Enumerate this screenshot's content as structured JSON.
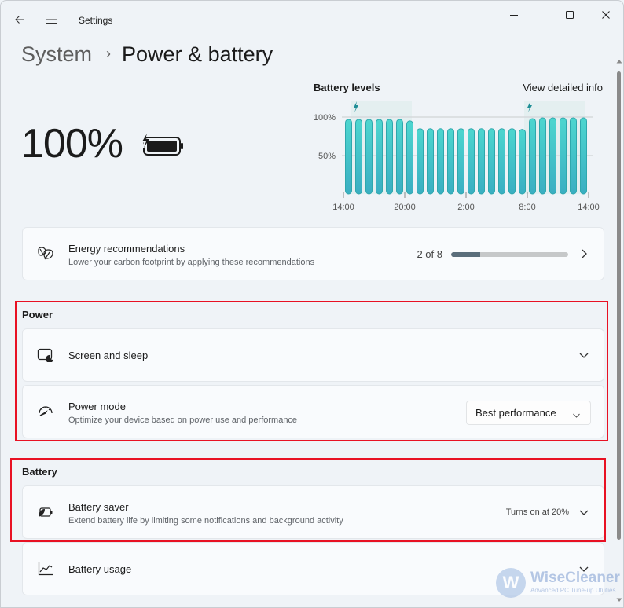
{
  "window": {
    "title": "Settings",
    "back_icon": "back-arrow-icon",
    "menu_icon": "hamburger-menu-icon",
    "controls": [
      "minimize",
      "maximize",
      "close"
    ]
  },
  "breadcrumb": {
    "parent": "System",
    "separator": "›",
    "current": "Power & battery"
  },
  "battery_status": {
    "percent_label": "100%",
    "icon": "battery-charging-icon"
  },
  "battery_levels": {
    "title": "Battery levels",
    "link_label": "View detailed info"
  },
  "chart_data": {
    "type": "bar",
    "title": "Battery levels",
    "xlabel": "",
    "ylabel": "",
    "ylim": [
      0,
      100
    ],
    "y_ticks": [
      "100%",
      "50%"
    ],
    "y_tick_values": [
      100,
      50
    ],
    "x_ticks": [
      "14:00",
      "20:00",
      "2:00",
      "8:00",
      "14:00"
    ],
    "x_tick_positions": [
      0,
      6,
      12,
      18,
      24
    ],
    "grid": true,
    "categories": [
      "14:00",
      "15:00",
      "16:00",
      "17:00",
      "18:00",
      "19:00",
      "20:00",
      "21:00",
      "22:00",
      "23:00",
      "0:00",
      "1:00",
      "2:00",
      "3:00",
      "4:00",
      "5:00",
      "6:00",
      "7:00",
      "8:00",
      "9:00",
      "10:00",
      "11:00",
      "12:00",
      "13:00"
    ],
    "values": [
      97,
      97,
      97,
      97,
      97,
      97,
      95,
      85,
      85,
      85,
      85,
      85,
      85,
      85,
      85,
      85,
      85,
      84,
      98,
      99,
      99,
      99,
      99,
      99
    ],
    "charging_periods": [
      {
        "start_hour_index": 1,
        "end_hour_index": 7
      },
      {
        "start_hour_index": 18,
        "end_hour_index": 24
      }
    ],
    "bar_color": "#3cc4c6",
    "charging_color": "#1f8e96"
  },
  "energy_recommendations": {
    "title": "Energy recommendations",
    "subtitle": "Lower your carbon footprint by applying these recommendations",
    "progress_text": "2 of 8",
    "progress_fraction": 0.25,
    "icon": "leaf-icon"
  },
  "power_section": {
    "label": "Power",
    "items": [
      {
        "title": "Screen and sleep",
        "icon": "screen-sleep-icon"
      },
      {
        "title": "Power mode",
        "subtitle": "Optimize your device based on power use and performance",
        "icon": "power-mode-gauge-icon",
        "dropdown_value": "Best performance"
      }
    ]
  },
  "battery_section": {
    "label": "Battery",
    "items": [
      {
        "title": "Battery saver",
        "subtitle": "Extend battery life by limiting some notifications and background activity",
        "status": "Turns on at 20%",
        "icon": "battery-saver-icon"
      },
      {
        "title": "Battery usage",
        "icon": "battery-usage-chart-icon"
      }
    ]
  },
  "watermark": {
    "brand": "WiseCleaner",
    "tagline": "Advanced PC Tune-up Utilities",
    "logo_letter": "W"
  },
  "colors": {
    "highlight_box": "#e81123",
    "accent_bar": "#3cc4c6",
    "progress_fill": "#5b6e7b"
  }
}
